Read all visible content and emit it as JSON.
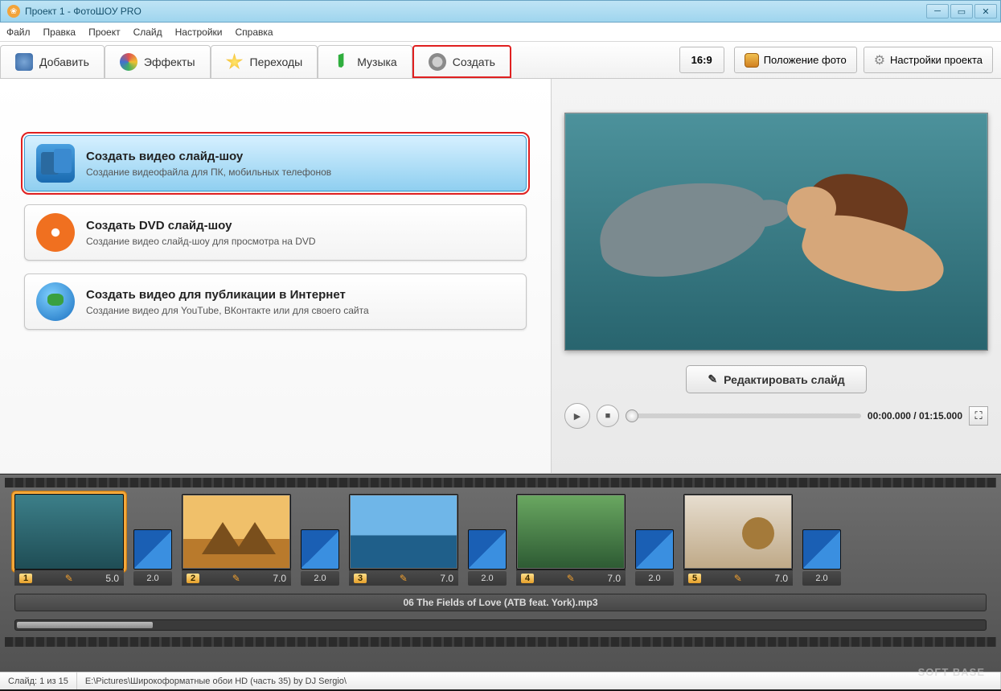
{
  "window": {
    "title": "Проект 1 - ФотоШОУ PRO"
  },
  "menu": {
    "file": "Файл",
    "edit": "Правка",
    "project": "Проект",
    "slide": "Слайд",
    "settings": "Настройки",
    "help": "Справка"
  },
  "tabs": {
    "add": "Добавить",
    "effects": "Эффекты",
    "transitions": "Переходы",
    "music": "Музыка",
    "create": "Создать"
  },
  "top_right": {
    "aspect": "16:9",
    "photo_pos": "Положение фото",
    "proj_settings": "Настройки проекта"
  },
  "create_options": [
    {
      "title": "Создать видео слайд-шоу",
      "sub": "Создание видеофайла для ПК, мобильных телефонов"
    },
    {
      "title": "Создать DVD слайд-шоу",
      "sub": "Создание видео слайд-шоу для просмотра на DVD"
    },
    {
      "title": "Создать видео для публикации в Интернет",
      "sub": "Создание видео для YouTube, ВКонтакте или для своего сайта"
    }
  ],
  "preview": {
    "edit_btn": "Редактировать слайд",
    "time": "00:00.000 / 01:15.000"
  },
  "timeline": {
    "slides": [
      {
        "n": "1",
        "dur": "5.0",
        "trans": "2.0"
      },
      {
        "n": "2",
        "dur": "7.0",
        "trans": "2.0"
      },
      {
        "n": "3",
        "dur": "7.0",
        "trans": "2.0"
      },
      {
        "n": "4",
        "dur": "7.0",
        "trans": "2.0"
      },
      {
        "n": "5",
        "dur": "7.0",
        "trans": "2.0"
      }
    ],
    "audio": "06 The Fields of Love (ATB feat. York).mp3"
  },
  "status": {
    "slide": "Слайд: 1 из 15",
    "path": "E:\\Pictures\\Широкоформатные обои HD (часть 35) by DJ Sergio\\"
  },
  "watermark": "SOFT BASE"
}
